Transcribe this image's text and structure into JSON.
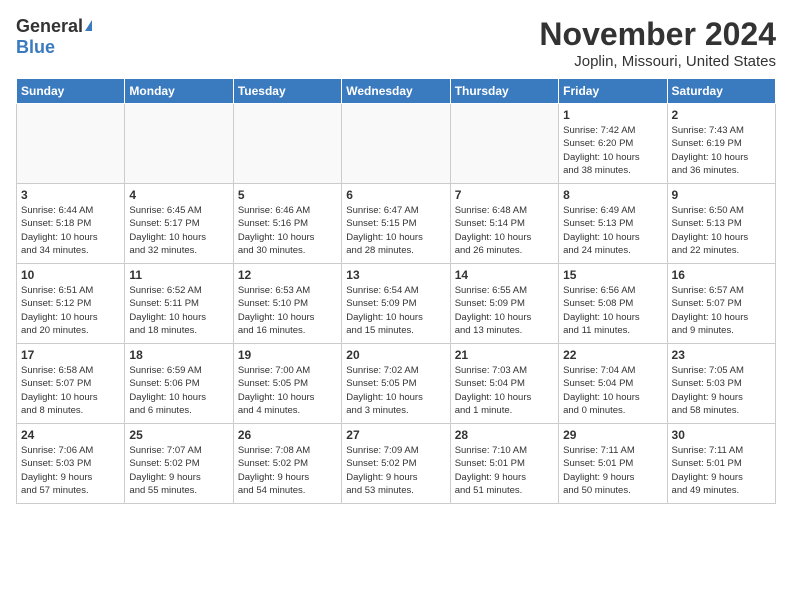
{
  "logo": {
    "general": "General",
    "blue": "Blue"
  },
  "title": "November 2024",
  "location": "Joplin, Missouri, United States",
  "weekdays": [
    "Sunday",
    "Monday",
    "Tuesday",
    "Wednesday",
    "Thursday",
    "Friday",
    "Saturday"
  ],
  "weeks": [
    [
      {
        "day": "",
        "detail": ""
      },
      {
        "day": "",
        "detail": ""
      },
      {
        "day": "",
        "detail": ""
      },
      {
        "day": "",
        "detail": ""
      },
      {
        "day": "",
        "detail": ""
      },
      {
        "day": "1",
        "detail": "Sunrise: 7:42 AM\nSunset: 6:20 PM\nDaylight: 10 hours\nand 38 minutes."
      },
      {
        "day": "2",
        "detail": "Sunrise: 7:43 AM\nSunset: 6:19 PM\nDaylight: 10 hours\nand 36 minutes."
      }
    ],
    [
      {
        "day": "3",
        "detail": "Sunrise: 6:44 AM\nSunset: 5:18 PM\nDaylight: 10 hours\nand 34 minutes."
      },
      {
        "day": "4",
        "detail": "Sunrise: 6:45 AM\nSunset: 5:17 PM\nDaylight: 10 hours\nand 32 minutes."
      },
      {
        "day": "5",
        "detail": "Sunrise: 6:46 AM\nSunset: 5:16 PM\nDaylight: 10 hours\nand 30 minutes."
      },
      {
        "day": "6",
        "detail": "Sunrise: 6:47 AM\nSunset: 5:15 PM\nDaylight: 10 hours\nand 28 minutes."
      },
      {
        "day": "7",
        "detail": "Sunrise: 6:48 AM\nSunset: 5:14 PM\nDaylight: 10 hours\nand 26 minutes."
      },
      {
        "day": "8",
        "detail": "Sunrise: 6:49 AM\nSunset: 5:13 PM\nDaylight: 10 hours\nand 24 minutes."
      },
      {
        "day": "9",
        "detail": "Sunrise: 6:50 AM\nSunset: 5:13 PM\nDaylight: 10 hours\nand 22 minutes."
      }
    ],
    [
      {
        "day": "10",
        "detail": "Sunrise: 6:51 AM\nSunset: 5:12 PM\nDaylight: 10 hours\nand 20 minutes."
      },
      {
        "day": "11",
        "detail": "Sunrise: 6:52 AM\nSunset: 5:11 PM\nDaylight: 10 hours\nand 18 minutes."
      },
      {
        "day": "12",
        "detail": "Sunrise: 6:53 AM\nSunset: 5:10 PM\nDaylight: 10 hours\nand 16 minutes."
      },
      {
        "day": "13",
        "detail": "Sunrise: 6:54 AM\nSunset: 5:09 PM\nDaylight: 10 hours\nand 15 minutes."
      },
      {
        "day": "14",
        "detail": "Sunrise: 6:55 AM\nSunset: 5:09 PM\nDaylight: 10 hours\nand 13 minutes."
      },
      {
        "day": "15",
        "detail": "Sunrise: 6:56 AM\nSunset: 5:08 PM\nDaylight: 10 hours\nand 11 minutes."
      },
      {
        "day": "16",
        "detail": "Sunrise: 6:57 AM\nSunset: 5:07 PM\nDaylight: 10 hours\nand 9 minutes."
      }
    ],
    [
      {
        "day": "17",
        "detail": "Sunrise: 6:58 AM\nSunset: 5:07 PM\nDaylight: 10 hours\nand 8 minutes."
      },
      {
        "day": "18",
        "detail": "Sunrise: 6:59 AM\nSunset: 5:06 PM\nDaylight: 10 hours\nand 6 minutes."
      },
      {
        "day": "19",
        "detail": "Sunrise: 7:00 AM\nSunset: 5:05 PM\nDaylight: 10 hours\nand 4 minutes."
      },
      {
        "day": "20",
        "detail": "Sunrise: 7:02 AM\nSunset: 5:05 PM\nDaylight: 10 hours\nand 3 minutes."
      },
      {
        "day": "21",
        "detail": "Sunrise: 7:03 AM\nSunset: 5:04 PM\nDaylight: 10 hours\nand 1 minute."
      },
      {
        "day": "22",
        "detail": "Sunrise: 7:04 AM\nSunset: 5:04 PM\nDaylight: 10 hours\nand 0 minutes."
      },
      {
        "day": "23",
        "detail": "Sunrise: 7:05 AM\nSunset: 5:03 PM\nDaylight: 9 hours\nand 58 minutes."
      }
    ],
    [
      {
        "day": "24",
        "detail": "Sunrise: 7:06 AM\nSunset: 5:03 PM\nDaylight: 9 hours\nand 57 minutes."
      },
      {
        "day": "25",
        "detail": "Sunrise: 7:07 AM\nSunset: 5:02 PM\nDaylight: 9 hours\nand 55 minutes."
      },
      {
        "day": "26",
        "detail": "Sunrise: 7:08 AM\nSunset: 5:02 PM\nDaylight: 9 hours\nand 54 minutes."
      },
      {
        "day": "27",
        "detail": "Sunrise: 7:09 AM\nSunset: 5:02 PM\nDaylight: 9 hours\nand 53 minutes."
      },
      {
        "day": "28",
        "detail": "Sunrise: 7:10 AM\nSunset: 5:01 PM\nDaylight: 9 hours\nand 51 minutes."
      },
      {
        "day": "29",
        "detail": "Sunrise: 7:11 AM\nSunset: 5:01 PM\nDaylight: 9 hours\nand 50 minutes."
      },
      {
        "day": "30",
        "detail": "Sunrise: 7:11 AM\nSunset: 5:01 PM\nDaylight: 9 hours\nand 49 minutes."
      }
    ]
  ]
}
